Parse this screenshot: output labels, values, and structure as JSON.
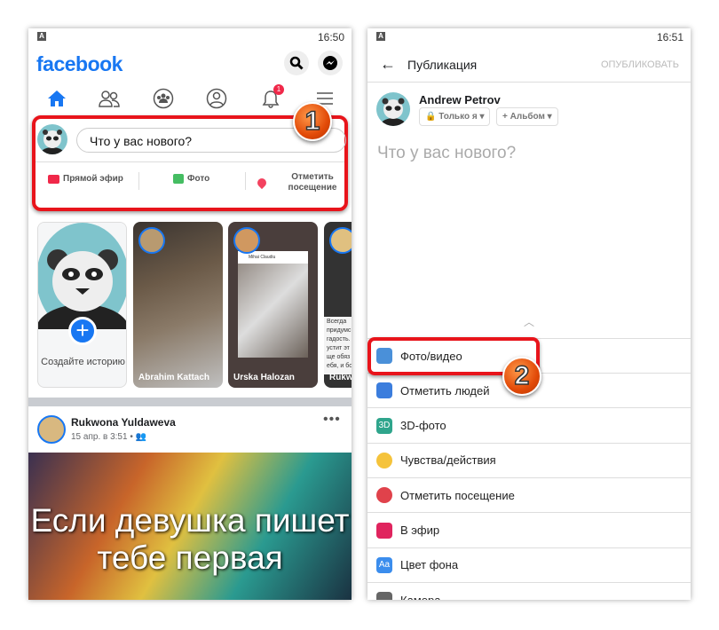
{
  "left": {
    "status": {
      "time": "16:50",
      "indicator": "A"
    },
    "header": {
      "logo": "facebook",
      "icons": [
        "search-icon",
        "messenger-icon"
      ]
    },
    "nav": {
      "icons": [
        "home-icon",
        "friends-icon",
        "groups-icon",
        "profile-icon",
        "bell-icon",
        "menu-icon"
      ],
      "notification_count": "1",
      "active_color": "#1877f2"
    },
    "composer": {
      "placeholder": "Что у вас нового?",
      "actions": [
        {
          "label": "Прямой эфир",
          "icon": "live-icon"
        },
        {
          "label": "Фото",
          "icon": "photo-icon"
        },
        {
          "label": "Отметить посещение",
          "icon": "location-icon"
        }
      ]
    },
    "step_badge": "1",
    "stories": [
      {
        "label": "Создайте историю"
      },
      {
        "label": "Abrahim Kattach"
      },
      {
        "label": "Urska Halozan",
        "inner_name": "Mihai Claudiu"
      },
      {
        "label": "Rukw",
        "text": "Всегда придумс гадость. устит эт ще обяз ебя, и бо"
      }
    ],
    "post": {
      "author": "Rukwona Yuldaweva",
      "date": "15 апр. в 3:51 •",
      "image_text": "Если девушка пишет тебе первая"
    }
  },
  "right": {
    "status": {
      "time": "16:51",
      "indicator": "A"
    },
    "header": {
      "title": "Публикация",
      "publish": "ОПУБЛИКОВАТЬ"
    },
    "user": {
      "name": "Andrew Petrov",
      "privacy": "Только я",
      "album": "+ Альбом"
    },
    "placeholder": "Что у вас нового?",
    "options": [
      {
        "label": "Фото/видео",
        "icon": "photo-video-icon",
        "color": "#4a90d9"
      },
      {
        "label": "Отметить людей",
        "icon": "tag-people-icon",
        "color": "#3b7ddd"
      },
      {
        "label": "3D-фото",
        "icon": "3d-photo-icon",
        "color": "#2fa58c",
        "glyph": "3D"
      },
      {
        "label": "Чувства/действия",
        "icon": "feeling-icon",
        "color": "#f5c33b"
      },
      {
        "label": "Отметить посещение",
        "icon": "location-icon",
        "color": "#e0424b"
      },
      {
        "label": "В эфир",
        "icon": "live-icon",
        "color": "#e0245e"
      },
      {
        "label": "Цвет фона",
        "icon": "background-color-icon",
        "color": "#3b8ded",
        "glyph": "Aa"
      },
      {
        "label": "Камера",
        "icon": "camera-icon",
        "color": "#666"
      }
    ],
    "step_badge": "2"
  },
  "highlight_color": "#e8141b"
}
